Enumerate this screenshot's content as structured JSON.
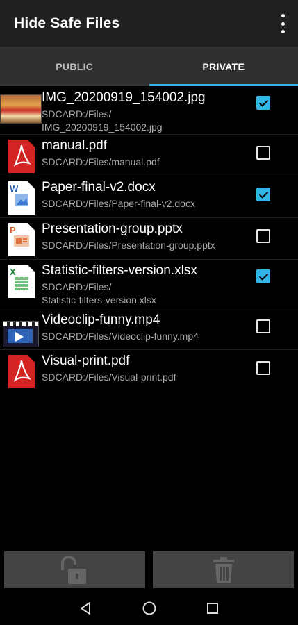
{
  "app": {
    "title": "Hide Safe Files"
  },
  "tabs": [
    {
      "label": "PUBLIC",
      "active": false
    },
    {
      "label": "PRIVATE",
      "active": true
    }
  ],
  "colors": {
    "accent": "#33b5e5",
    "appbar": "#212121",
    "tabbar": "#303030",
    "button": "#444444"
  },
  "files": [
    {
      "name": "IMG_20200919_154002.jpg",
      "path": "SDCARD:/Files/\nIMG_20200919_154002.jpg",
      "icon": "image-thumbnail-icon",
      "checked": true
    },
    {
      "name": "manual.pdf",
      "path": "SDCARD:/Files/manual.pdf",
      "icon": "pdf-file-icon",
      "checked": false
    },
    {
      "name": "Paper-final-v2.docx",
      "path": "SDCARD:/Files/Paper-final-v2.docx",
      "icon": "word-file-icon",
      "checked": true
    },
    {
      "name": "Presentation-group.pptx",
      "path": "SDCARD:/Files/Presentation-group.pptx",
      "icon": "powerpoint-file-icon",
      "checked": false
    },
    {
      "name": "Statistic-filters-version.xlsx",
      "path": "SDCARD:/Files/\nStatistic-filters-version.xlsx",
      "icon": "excel-file-icon",
      "checked": true
    },
    {
      "name": "Videoclip-funny.mp4",
      "path": "SDCARD:/Files/Videoclip-funny.mp4",
      "icon": "video-thumbnail-icon",
      "checked": false
    },
    {
      "name": "Visual-print.pdf",
      "path": "SDCARD:/Files/Visual-print.pdf",
      "icon": "pdf-file-icon",
      "checked": false
    }
  ],
  "actions": {
    "unlock_icon": "unlock-icon",
    "delete_icon": "trash-icon"
  },
  "navigation": {
    "back_icon": "back-icon",
    "home_icon": "home-icon",
    "recents_icon": "recents-icon"
  }
}
